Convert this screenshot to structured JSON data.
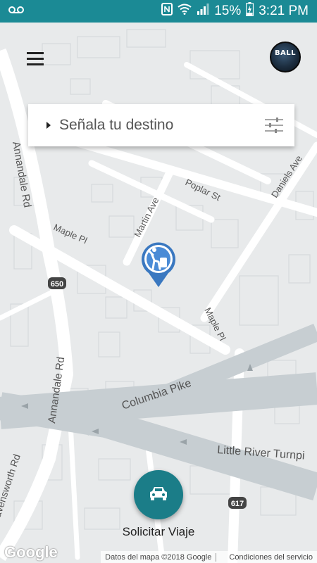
{
  "status_bar": {
    "battery": "15%",
    "time": "3:21 PM",
    "icons": [
      "voicemail-icon",
      "nfc-icon",
      "wifi-icon",
      "signal-icon",
      "battery-charging-icon"
    ]
  },
  "header": {
    "menu_icon": "hamburger-menu-icon",
    "logo_text": "BALL"
  },
  "search": {
    "placeholder": "Señala tu destino",
    "filter_icon": "sliders-icon"
  },
  "map": {
    "streets": [
      "Annandale Rd",
      "Poplar St",
      "Daniels Ave",
      "Martin Ave",
      "Maple Pl",
      "Maple Pl",
      "Columbia Pike",
      "Little River Turnpi",
      "Annandale Rd",
      "avensworth Rd"
    ],
    "route_shields": [
      "650",
      "617"
    ]
  },
  "request_button": {
    "label": "Solicitar Viaje",
    "icon": "car-icon"
  },
  "footer": {
    "google_logo": "Google",
    "map_data": "Datos del mapa ©2018 Google",
    "terms": "Condiciones del servicio"
  },
  "colors": {
    "accent": "#1b8a95",
    "fab": "#1b7d88",
    "pin": "#3a78c0",
    "map_bg": "#e8eaeb",
    "road": "#ffffff",
    "highway": "#c7ced2"
  }
}
